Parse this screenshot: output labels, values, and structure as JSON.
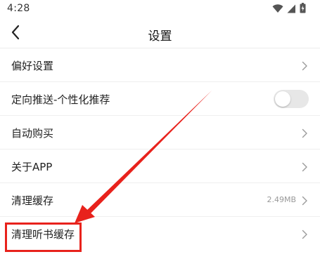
{
  "status_bar": {
    "time": "4:28",
    "icons": [
      "wifi-icon",
      "cellular-signal-icon",
      "battery-charging-icon"
    ]
  },
  "header": {
    "title": "设置",
    "back_icon": "back-arrow-icon"
  },
  "settings": {
    "items": [
      {
        "label": "偏好设置"
      },
      {
        "label": "定向推送-个性化推荐",
        "toggle_on": false
      },
      {
        "label": "自动购买"
      },
      {
        "label": "关于APP"
      },
      {
        "label": "清理缓存",
        "value": "2.49MB"
      },
      {
        "label": "清理听书缓存"
      }
    ]
  },
  "colors": {
    "annotation": "#e8221c",
    "toggle_off": "#e7e7e7",
    "divider": "#efefef"
  }
}
